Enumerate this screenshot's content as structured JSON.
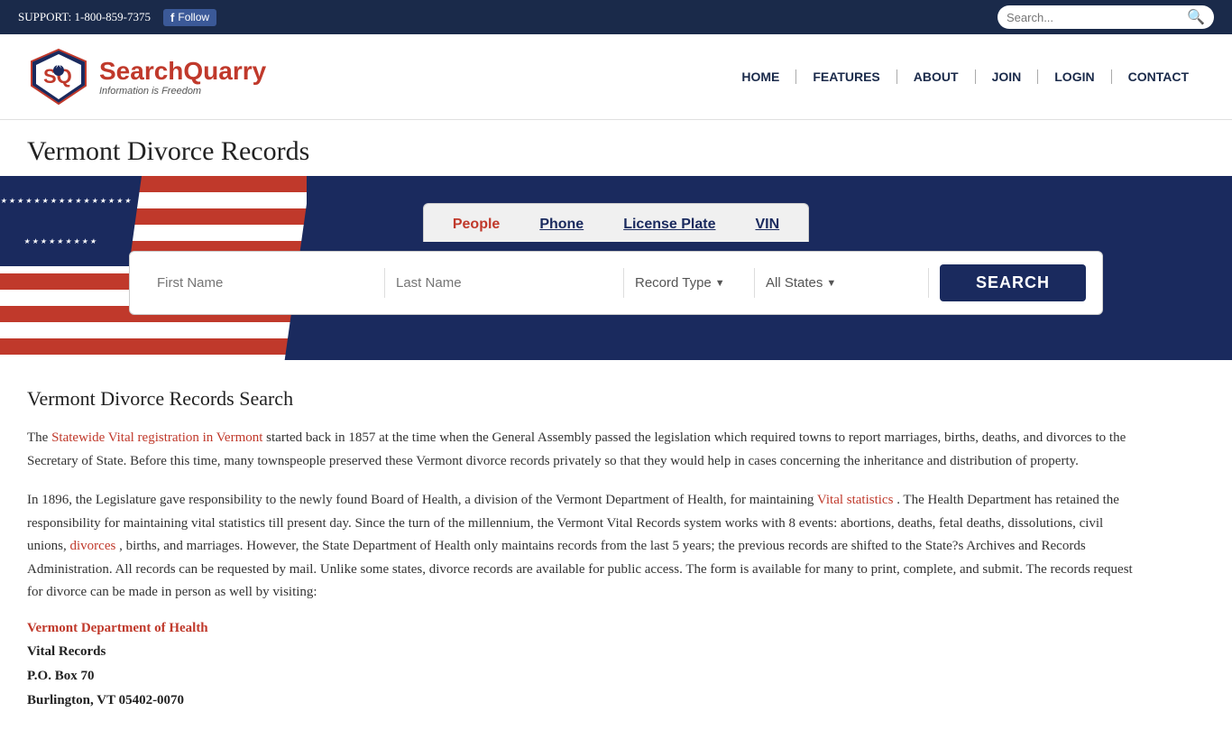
{
  "topbar": {
    "support_label": "SUPPORT:",
    "phone": "1-800-859-7375",
    "fb_follow": "Follow",
    "search_placeholder": "Search..."
  },
  "nav": {
    "logo_brand_part1": "Search",
    "logo_brand_part2": "Quarry",
    "logo_tagline": "Information is Freedom",
    "items": [
      {
        "label": "HOME",
        "id": "home"
      },
      {
        "label": "FEATURES",
        "id": "features"
      },
      {
        "label": "ABOUT",
        "id": "about"
      },
      {
        "label": "JOIN",
        "id": "join"
      },
      {
        "label": "LOGIN",
        "id": "login"
      },
      {
        "label": "CONTACT",
        "id": "contact"
      }
    ]
  },
  "page": {
    "title": "Vermont Divorce Records"
  },
  "search_tabs": [
    {
      "label": "People",
      "active": true
    },
    {
      "label": "Phone",
      "active": false
    },
    {
      "label": "License Plate",
      "active": false
    },
    {
      "label": "VIN",
      "active": false
    }
  ],
  "search_form": {
    "first_name_placeholder": "First Name",
    "last_name_placeholder": "Last Name",
    "record_type_label": "Record Type",
    "all_states_label": "All States",
    "search_button": "SEARCH"
  },
  "content": {
    "section_title": "Vermont Divorce Records Search",
    "paragraph1": "The Statewide Vital registration in Vermont started back in 1857 at the time when the General Assembly passed the legislation which required towns to report marriages, births, deaths, and divorces to the Secretary of State. Before this time, many townspeople preserved these Vermont divorce records privately so that they would help in cases concerning the inheritance and distribution of property.",
    "link1_text": "Statewide Vital registration in Vermont",
    "paragraph2_before": "In 1896, the Legislature gave responsibility to the newly found Board of Health, a division of the Vermont Department of Health, for maintaining ",
    "link2_text": "Vital statistics",
    "paragraph2_after": ". The Health Department has retained the responsibility for maintaining vital statistics till present day. Since the turn of the millennium, the Vermont Vital Records system works with 8 events: abortions, deaths, fetal deaths, dissolutions, civil unions, ",
    "link3_text": "divorces",
    "paragraph2_end": ", births, and marriages. However, the State Department of Health only maintains records from the last 5 years; the previous records are shifted to the State?s Archives and Records Administration. All records can be requested by mail. Unlike some states, divorce records are available for public access. The form is available for many to print, complete, and submit. The records request for divorce can be made in person as well by visiting:",
    "dept_name": "Vermont Department of Health",
    "address_line1": "Vital Records",
    "address_line2": "P.O. Box 70",
    "address_line3": "Burlington, VT 05402-0070"
  }
}
